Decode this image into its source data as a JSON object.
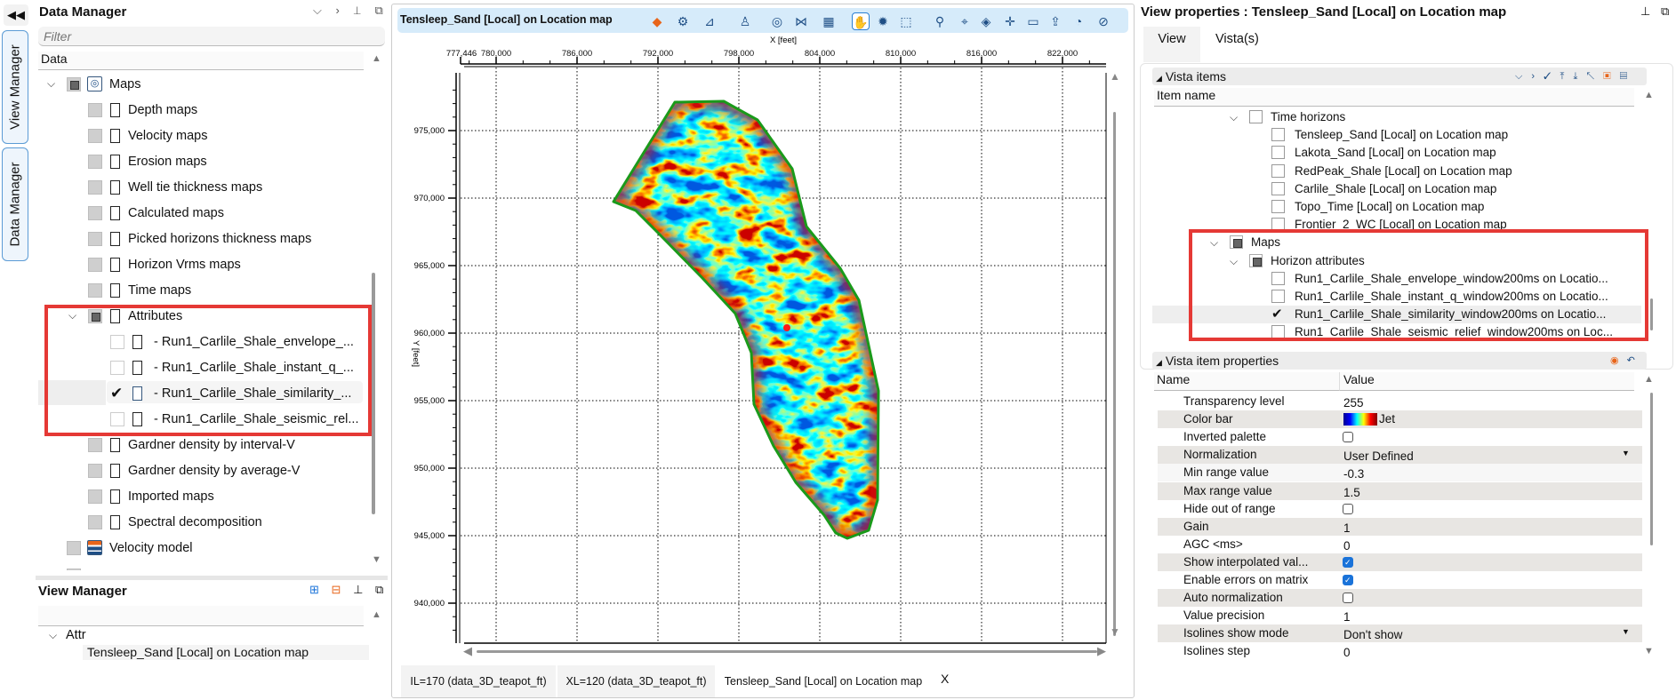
{
  "side_tabs": {
    "collapse": "◀◀",
    "view_manager": "View Manager",
    "data_manager": "Data Manager"
  },
  "data_manager": {
    "title": "Data Manager",
    "header_icons": [
      "chevron-down",
      "chevron-right",
      "pin",
      "restore"
    ],
    "filter_placeholder": "Filter",
    "column": "Data",
    "items": [
      {
        "label": "Maps",
        "depth": 0,
        "expanded": true,
        "state": "partial",
        "icon": "maps-icon"
      },
      {
        "label": "Depth maps",
        "depth": 1,
        "state": "off"
      },
      {
        "label": "Velocity maps",
        "depth": 1,
        "state": "off"
      },
      {
        "label": "Erosion maps",
        "depth": 1,
        "state": "off"
      },
      {
        "label": "Well tie thickness maps",
        "depth": 1,
        "state": "off"
      },
      {
        "label": "Calculated maps",
        "depth": 1,
        "state": "off"
      },
      {
        "label": "Picked horizons thickness maps",
        "depth": 1,
        "state": "off"
      },
      {
        "label": "Horizon Vrms maps",
        "depth": 1,
        "state": "off"
      },
      {
        "label": "Time maps",
        "depth": 1,
        "state": "off"
      },
      {
        "label": "Attributes",
        "depth": 1,
        "expanded": true,
        "state": "partial"
      },
      {
        "label": "- Run1_Carlile_Shale_envelope_...",
        "depth": 2,
        "state": "off"
      },
      {
        "label": "- Run1_Carlile_Shale_instant_q_...",
        "depth": 2,
        "state": "off"
      },
      {
        "label": "- Run1_Carlile_Shale_similarity_...",
        "depth": 2,
        "state": "checked",
        "selected": true
      },
      {
        "label": "- Run1_Carlile_Shale_seismic_rel...",
        "depth": 2,
        "state": "off"
      },
      {
        "label": "Gardner density by interval-V",
        "depth": 1,
        "state": "off"
      },
      {
        "label": "Gardner density by average-V",
        "depth": 1,
        "state": "off"
      },
      {
        "label": "Imported maps",
        "depth": 1,
        "state": "off"
      },
      {
        "label": "Spectral decomposition",
        "depth": 1,
        "state": "off"
      },
      {
        "label": "Velocity model",
        "depth": 0,
        "state": "off",
        "icon": "velocity-model-icon"
      }
    ]
  },
  "view_manager": {
    "title": "View Manager",
    "header_icons": [
      "add-view",
      "remove-view",
      "pin",
      "restore"
    ],
    "group": "Attr",
    "item": "Tensleep_Sand [Local] on Location map"
  },
  "map_view": {
    "title": "Tensleep_Sand [Local] on Location map",
    "toolbar": [
      "fill-icon",
      "map-settings-icon",
      "map-display-icon",
      "well-icon",
      "contour-map-icon",
      "section-icon",
      "layer-options-icon",
      "pan-hand-icon",
      "settings-gear-icon",
      "select-region-icon",
      "zoom-icon",
      "mouse-icon",
      "layers-icon",
      "crosshair-icon",
      "comment-icon",
      "export-image-icon",
      "measure-icon",
      "compass-icon"
    ],
    "active_tool": "pan-hand-icon",
    "x_axis": {
      "label": "X [feet]",
      "start_label": "777,446",
      "ticks": [
        "780,000",
        "786,000",
        "792,000",
        "798,000",
        "804,000",
        "810,000",
        "816,000",
        "822,000"
      ],
      "values": [
        780000,
        786000,
        792000,
        798000,
        804000,
        810000,
        816000,
        822000
      ]
    },
    "y_axis": {
      "label": "Y [feet]",
      "ticks": [
        "975,000",
        "970,000",
        "965,000",
        "960,000",
        "955,000",
        "950,000",
        "945,000",
        "940,000"
      ],
      "values": [
        975000,
        970000,
        965000,
        960000,
        955000,
        950000,
        945000,
        940000
      ]
    },
    "boundary_color": "#1a9a1a",
    "palette": "Jet",
    "marker_color": "#ff1a1a"
  },
  "bottom_tabs": [
    {
      "label": "IL=170 (data_3D_teapot_ft)",
      "active": false
    },
    {
      "label": "XL=120 (data_3D_teapot_ft)",
      "active": false
    },
    {
      "label": "Tensleep_Sand [Local] on Location map",
      "active": true,
      "close": "X"
    }
  ],
  "view_properties": {
    "title": "View properties : Tensleep_Sand [Local] on Location map",
    "tabs": [
      {
        "label": "View",
        "active": true
      },
      {
        "label": "Vista(s)",
        "active": false
      }
    ],
    "vista_items": {
      "title": "Vista items",
      "column": "Item name",
      "items": [
        {
          "label": "Time horizons",
          "depth": 0,
          "expanded": true,
          "state": "off"
        },
        {
          "label": "Tensleep_Sand [Local] on Location map",
          "depth": 1,
          "state": "off"
        },
        {
          "label": "Lakota_Sand [Local] on Location map",
          "depth": 1,
          "state": "off"
        },
        {
          "label": "RedPeak_Shale [Local] on Location map",
          "depth": 1,
          "state": "off"
        },
        {
          "label": "Carlile_Shale [Local] on Location map",
          "depth": 1,
          "state": "off"
        },
        {
          "label": "Topo_Time [Local] on Location map",
          "depth": 1,
          "state": "off"
        },
        {
          "label": "Frontier_2_WC [Local] on Location map",
          "depth": 1,
          "state": "off"
        },
        {
          "label": "Maps",
          "depth": -1,
          "expanded": true,
          "state": "partial"
        },
        {
          "label": "Horizon attributes",
          "depth": 0,
          "expanded": true,
          "state": "partial"
        },
        {
          "label": "Run1_Carlile_Shale_envelope_window200ms on Locatio...",
          "depth": 1,
          "state": "off"
        },
        {
          "label": "Run1_Carlile_Shale_instant_q_window200ms on Locatio...",
          "depth": 1,
          "state": "off"
        },
        {
          "label": "Run1_Carlile_Shale_similarity_window200ms on Locatio...",
          "depth": 1,
          "state": "checked",
          "selected": true
        },
        {
          "label": "Run1_Carlile_Shale_seismic_relief_window200ms on Loc...",
          "depth": 1,
          "state": "off"
        }
      ]
    },
    "item_properties": {
      "title": "Vista item properties",
      "columns": [
        "Name",
        "Value"
      ],
      "rows": [
        {
          "name": "Transparency level",
          "type": "text",
          "value": "255"
        },
        {
          "name": "Color bar",
          "type": "colorbar",
          "value": "Jet"
        },
        {
          "name": "Inverted palette",
          "type": "checkbox",
          "checked": false
        },
        {
          "name": "Normalization",
          "type": "dropdown",
          "value": "User Defined"
        },
        {
          "name": "Min range value",
          "type": "text",
          "value": "-0.3"
        },
        {
          "name": "Max range value",
          "type": "text",
          "value": "1.5"
        },
        {
          "name": "Hide out of range",
          "type": "checkbox",
          "checked": false
        },
        {
          "name": "Gain",
          "type": "text",
          "value": "1"
        },
        {
          "name": "AGC <ms>",
          "type": "text",
          "value": "0"
        },
        {
          "name": "Show interpolated val...",
          "type": "checkbox",
          "checked": true
        },
        {
          "name": "Enable errors on matrix",
          "type": "checkbox",
          "checked": true
        },
        {
          "name": "Auto normalization",
          "type": "checkbox",
          "checked": false
        },
        {
          "name": "Value precision",
          "type": "text",
          "value": "1"
        },
        {
          "name": "Isolines show mode",
          "type": "dropdown",
          "value": "Don't show"
        },
        {
          "name": "Isolines step",
          "type": "text",
          "value": "0"
        }
      ]
    }
  },
  "colors": {
    "highlight_box": "#e53935",
    "toolbar_bg": "#d6ebfa",
    "checkbox_on": "#1a73d9"
  }
}
